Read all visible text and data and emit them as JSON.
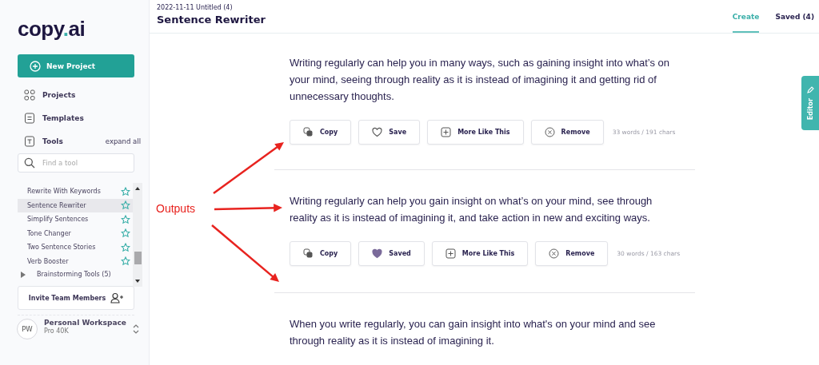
{
  "sidebar": {
    "logo": {
      "left": "copy",
      "dot": ".",
      "right": "ai"
    },
    "new_project": "New Project",
    "nav": [
      {
        "label": "Projects"
      },
      {
        "label": "Templates"
      },
      {
        "label": "Tools"
      }
    ],
    "expand_all": "expand all",
    "search": {
      "placeholder": "Find a tool"
    },
    "tools": [
      {
        "label": "Rewrite With Keywords",
        "selected": false
      },
      {
        "label": "Sentence Rewriter",
        "selected": true
      },
      {
        "label": "Simplify Sentences",
        "selected": false
      },
      {
        "label": "Tone Changer",
        "selected": false
      },
      {
        "label": "Two Sentence Stories",
        "selected": false
      },
      {
        "label": "Verb Booster",
        "selected": false
      }
    ],
    "group": {
      "label": "Brainstorming Tools (5)",
      "expanded": false
    },
    "invite": "Invite Team Members",
    "workspace": {
      "initials": "PW",
      "name": "Personal Workspace",
      "plan": "Pro 40K"
    }
  },
  "header": {
    "subtitle": "2022-11-11 Untitled (4)",
    "title": "Sentence Rewriter",
    "tabs": [
      {
        "label": "Create",
        "selected": true
      },
      {
        "label": "Saved (4)",
        "selected": false
      }
    ]
  },
  "editor_tab": "Editor",
  "outputs": [
    {
      "text": "Writing regularly can help you in many ways, such as gaining insight into what’s on your mind, seeing through reality as it is instead of imagining it and getting rid of unnecessary thoughts.",
      "copy": "Copy",
      "save": "Save",
      "saved": false,
      "more": "More Like This",
      "remove": "Remove",
      "count": "33 words / 191 chars"
    },
    {
      "text": "Writing regularly can help you gain insight on what’s on your mind, see through reality as it is instead of imagining it, and take action in new and exciting ways.",
      "copy": "Copy",
      "save": "Saved",
      "saved": true,
      "more": "More Like This",
      "remove": "Remove",
      "count": "30 words / 163 chars"
    },
    {
      "text": "When you write regularly, you can gain insight into what's on your mind and see through reality as it is instead of imagining it."
    }
  ],
  "annotation": {
    "label": "Outputs"
  }
}
